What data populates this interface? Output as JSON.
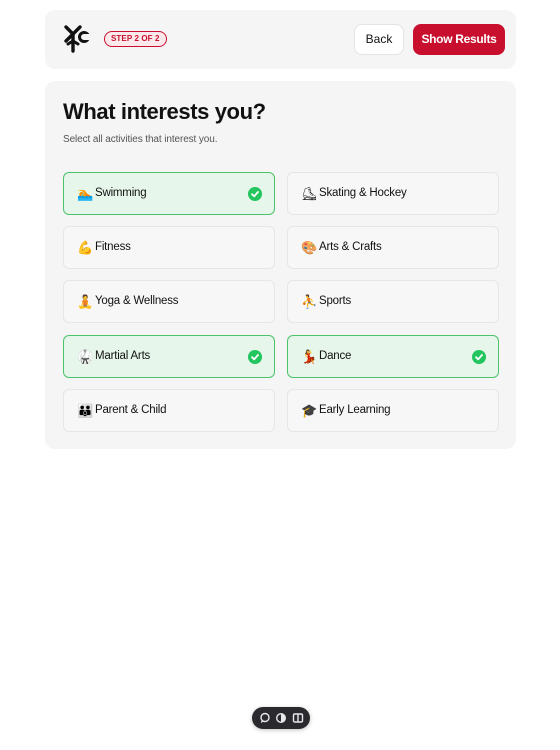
{
  "header": {
    "step_label": "STEP 2 OF 2",
    "back_label": "Back",
    "results_label": "Show Results"
  },
  "main": {
    "title": "What interests you?",
    "subtitle": "Select all activities that interest you."
  },
  "options": [
    {
      "label": "Swimming",
      "emoji": "🏊",
      "selected": true
    },
    {
      "label": "Skating & Hockey",
      "emoji": "⛸",
      "selected": false
    },
    {
      "label": "Fitness",
      "emoji": "💪",
      "selected": false
    },
    {
      "label": "Arts & Crafts",
      "emoji": "🎨",
      "selected": false
    },
    {
      "label": "Yoga & Wellness",
      "emoji": "🧘",
      "selected": false
    },
    {
      "label": "Sports",
      "emoji": "⛹",
      "selected": false
    },
    {
      "label": "Martial Arts",
      "emoji": "🥋",
      "selected": true
    },
    {
      "label": "Dance",
      "emoji": "💃",
      "selected": true
    },
    {
      "label": "Parent & Child",
      "emoji": "👪",
      "selected": false
    },
    {
      "label": "Early Learning",
      "emoji": "🎓",
      "selected": false
    }
  ],
  "colors": {
    "brand": "#c8102e",
    "selected_bg": "#e6f6ea",
    "selected_border": "#4cc36a",
    "check": "#22c55e"
  },
  "icons": {
    "logo": "brand-logo-icon",
    "check": "check-circle-icon",
    "toolbar": [
      "comment-icon",
      "toggle-icon",
      "columns-icon"
    ]
  }
}
